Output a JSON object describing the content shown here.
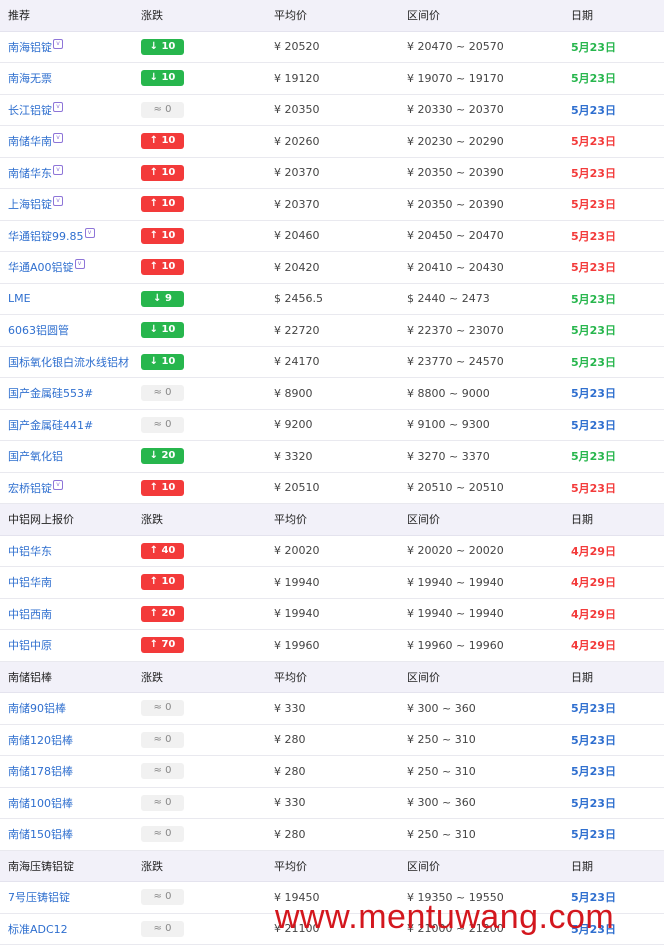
{
  "colors": {
    "up": "#f33a3a",
    "down": "#27b64d",
    "link": "#2f6fcf",
    "header_bg": "#f2f1f9",
    "watermark": "#d3171e"
  },
  "sections": [
    {
      "headers": [
        "推荐",
        "涨跌",
        "平均价",
        "区间价",
        "日期"
      ],
      "rows": [
        {
          "name": "南海铝锭",
          "tag": "v",
          "dir": "down",
          "chg": "↓ 10",
          "avg": "¥  20520",
          "range": "¥  20470 ~ 20570",
          "date": "5月23日",
          "date_color": "#27b64d"
        },
        {
          "name": "南海无票",
          "tag": "",
          "dir": "down",
          "chg": "↓ 10",
          "avg": "¥  19120",
          "range": "¥  19070 ~ 19170",
          "date": "5月23日",
          "date_color": "#27b64d"
        },
        {
          "name": "长江铝锭",
          "tag": "v",
          "dir": "flat",
          "chg": "≈ 0",
          "avg": "¥  20350",
          "range": "¥  20330 ~ 20370",
          "date": "5月23日",
          "date_color": "#2f6fcf"
        },
        {
          "name": "南储华南",
          "tag": "v",
          "dir": "up",
          "chg": "↑ 10",
          "avg": "¥  20260",
          "range": "¥  20230 ~ 20290",
          "date": "5月23日",
          "date_color": "#f33a3a"
        },
        {
          "name": "南储华东",
          "tag": "v",
          "dir": "up",
          "chg": "↑ 10",
          "avg": "¥  20370",
          "range": "¥  20350 ~ 20390",
          "date": "5月23日",
          "date_color": "#f33a3a"
        },
        {
          "name": "上海铝锭",
          "tag": "v",
          "dir": "up",
          "chg": "↑ 10",
          "avg": "¥  20370",
          "range": "¥  20350 ~ 20390",
          "date": "5月23日",
          "date_color": "#f33a3a"
        },
        {
          "name": "华通铝锭99.85",
          "tag": "v",
          "dir": "up",
          "chg": "↑ 10",
          "avg": "¥  20460",
          "range": "¥  20450 ~ 20470",
          "date": "5月23日",
          "date_color": "#f33a3a"
        },
        {
          "name": "华通A00铝锭",
          "tag": "v",
          "dir": "up",
          "chg": "↑ 10",
          "avg": "¥  20420",
          "range": "¥  20410 ~ 20430",
          "date": "5月23日",
          "date_color": "#f33a3a"
        },
        {
          "name": "LME",
          "tag": "",
          "dir": "down",
          "chg": "↓ 9",
          "avg": "$  2456.5",
          "range": "$  2440 ~ 2473",
          "date": "5月23日",
          "date_color": "#27b64d"
        },
        {
          "name": "6063铝圆管",
          "tag": "",
          "dir": "down",
          "chg": "↓ 10",
          "avg": "¥  22720",
          "range": "¥  22370 ~ 23070",
          "date": "5月23日",
          "date_color": "#27b64d"
        },
        {
          "name": "国标氧化银白流水线铝材",
          "tag": "",
          "dir": "down",
          "chg": "↓ 10",
          "avg": "¥  24170",
          "range": "¥  23770 ~ 24570",
          "date": "5月23日",
          "date_color": "#27b64d"
        },
        {
          "name": "国产金属硅553#",
          "tag": "",
          "dir": "flat",
          "chg": "≈ 0",
          "avg": "¥  8900",
          "range": "¥  8800 ~ 9000",
          "date": "5月23日",
          "date_color": "#2f6fcf"
        },
        {
          "name": "国产金属硅441#",
          "tag": "",
          "dir": "flat",
          "chg": "≈ 0",
          "avg": "¥  9200",
          "range": "¥  9100 ~ 9300",
          "date": "5月23日",
          "date_color": "#2f6fcf"
        },
        {
          "name": "国产氧化铝",
          "tag": "",
          "dir": "down",
          "chg": "↓ 20",
          "avg": "¥  3320",
          "range": "¥  3270 ~ 3370",
          "date": "5月23日",
          "date_color": "#27b64d"
        },
        {
          "name": "宏桥铝锭",
          "tag": "v",
          "dir": "up",
          "chg": "↑ 10",
          "avg": "¥  20510",
          "range": "¥  20510 ~ 20510",
          "date": "5月23日",
          "date_color": "#f33a3a"
        }
      ]
    },
    {
      "headers": [
        "中铝网上报价",
        "涨跌",
        "平均价",
        "区间价",
        "日期"
      ],
      "rows": [
        {
          "name": "中铝华东",
          "tag": "",
          "dir": "up",
          "chg": "↑ 40",
          "avg": "¥  20020",
          "range": "¥  20020 ~ 20020",
          "date": "4月29日",
          "date_color": "#f33a3a"
        },
        {
          "name": "中铝华南",
          "tag": "",
          "dir": "up",
          "chg": "↑ 10",
          "avg": "¥  19940",
          "range": "¥  19940 ~ 19940",
          "date": "4月29日",
          "date_color": "#f33a3a"
        },
        {
          "name": "中铝西南",
          "tag": "",
          "dir": "up",
          "chg": "↑ 20",
          "avg": "¥  19940",
          "range": "¥  19940 ~ 19940",
          "date": "4月29日",
          "date_color": "#f33a3a"
        },
        {
          "name": "中铝中原",
          "tag": "",
          "dir": "up",
          "chg": "↑ 70",
          "avg": "¥  19960",
          "range": "¥  19960 ~ 19960",
          "date": "4月29日",
          "date_color": "#f33a3a"
        }
      ]
    },
    {
      "headers": [
        "南储铝棒",
        "涨跌",
        "平均价",
        "区间价",
        "日期"
      ],
      "rows": [
        {
          "name": "南储90铝棒",
          "tag": "",
          "dir": "flat",
          "chg": "≈ 0",
          "avg": "¥  330",
          "range": "¥  300 ~ 360",
          "date": "5月23日",
          "date_color": "#2f6fcf"
        },
        {
          "name": "南储120铝棒",
          "tag": "",
          "dir": "flat",
          "chg": "≈ 0",
          "avg": "¥  280",
          "range": "¥  250 ~ 310",
          "date": "5月23日",
          "date_color": "#2f6fcf"
        },
        {
          "name": "南储178铝棒",
          "tag": "",
          "dir": "flat",
          "chg": "≈ 0",
          "avg": "¥  280",
          "range": "¥  250 ~ 310",
          "date": "5月23日",
          "date_color": "#2f6fcf"
        },
        {
          "name": "南储100铝棒",
          "tag": "",
          "dir": "flat",
          "chg": "≈ 0",
          "avg": "¥  330",
          "range": "¥  300 ~ 360",
          "date": "5月23日",
          "date_color": "#2f6fcf"
        },
        {
          "name": "南储150铝棒",
          "tag": "",
          "dir": "flat",
          "chg": "≈ 0",
          "avg": "¥  280",
          "range": "¥  250 ~ 310",
          "date": "5月23日",
          "date_color": "#2f6fcf"
        }
      ]
    },
    {
      "headers": [
        "南海压铸铝锭",
        "涨跌",
        "平均价",
        "区间价",
        "日期"
      ],
      "rows": [
        {
          "name": "7号压铸铝锭",
          "tag": "",
          "dir": "flat",
          "chg": "≈ 0",
          "avg": "¥  19450",
          "range": "¥  19350 ~ 19550",
          "date": "5月23日",
          "date_color": "#2f6fcf"
        },
        {
          "name": "标准ADC12",
          "tag": "",
          "dir": "flat",
          "chg": "≈ 0",
          "avg": "¥  21100",
          "range": "¥  21000 ~ 21200",
          "date": "5月23日",
          "date_color": "#2f6fcf"
        }
      ]
    }
  ],
  "watermark_text": "www.mentuwang.com"
}
